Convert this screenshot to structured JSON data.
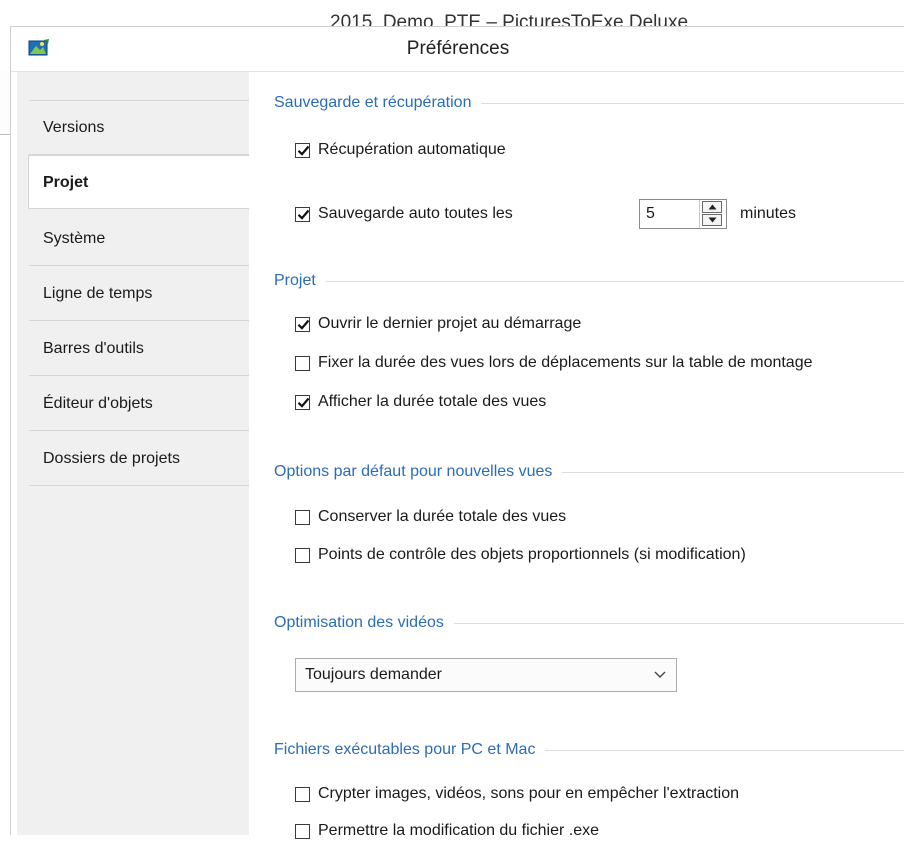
{
  "background": {
    "window_title": "2015_Demo_PTE – PicturesToExe Deluxe"
  },
  "dialog": {
    "title": "Préférences",
    "icon": "pictures-to-exe-app-icon"
  },
  "sidebar": {
    "items": [
      {
        "label": "Versions",
        "active": false
      },
      {
        "label": "Projet",
        "active": true
      },
      {
        "label": "Système",
        "active": false
      },
      {
        "label": "Ligne de temps",
        "active": false
      },
      {
        "label": "Barres d'outils",
        "active": false
      },
      {
        "label": "Éditeur d'objets",
        "active": false
      },
      {
        "label": "Dossiers de projets",
        "active": false
      }
    ]
  },
  "sections": {
    "save": {
      "heading": "Sauvegarde et récupération",
      "auto_recovery": {
        "label": "Récupération automatique",
        "checked": true
      },
      "auto_save": {
        "label": "Sauvegarde auto toutes les",
        "checked": true,
        "value": "5",
        "unit": "minutes"
      }
    },
    "project": {
      "heading": "Projet",
      "open_last": {
        "label": "Ouvrir le dernier projet au démarrage",
        "checked": true
      },
      "fix_duration": {
        "label": "Fixer la durée des vues lors de déplacements sur la table de montage",
        "checked": false
      },
      "show_total": {
        "label": "Afficher la durée totale des vues",
        "checked": true
      }
    },
    "defaults": {
      "heading": "Options par défaut pour nouvelles vues",
      "keep_total": {
        "label": "Conserver la durée totale des vues",
        "checked": false
      },
      "proportional": {
        "label": "Points de contrôle des objets proportionnels (si modification)",
        "checked": false
      }
    },
    "video": {
      "heading": "Optimisation des vidéos",
      "selected": "Toujours demander"
    },
    "executables": {
      "heading": "Fichiers exécutables pour PC et Mac",
      "encrypt": {
        "label": "Crypter images, vidéos, sons pour en empêcher l'extraction",
        "checked": false
      },
      "allow_modify": {
        "label": "Permettre la modification du fichier .exe",
        "checked": false
      }
    }
  },
  "colors": {
    "accent": "#2b6cb7",
    "sidebar_bg": "#f0f0f0"
  }
}
